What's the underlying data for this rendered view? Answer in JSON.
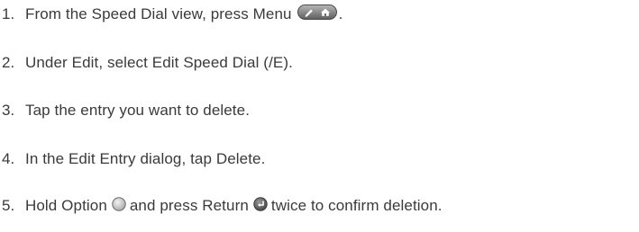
{
  "steps": [
    {
      "number": "1.",
      "text": "From the Speed Dial view, press Menu",
      "after": "."
    },
    {
      "number": "2.",
      "text": "Under Edit, select Edit Speed Dial (/E)."
    },
    {
      "number": "3.",
      "text": "Tap the entry you want to delete."
    },
    {
      "number": "4.",
      "text": "In the Edit Entry dialog, tap Delete."
    },
    {
      "number": "5.",
      "text_a": "Hold Option",
      "text_b": "and press Return",
      "text_c": "twice to confirm deletion."
    }
  ],
  "icons": {
    "menu_key": "menu-key-icon",
    "option_key": "option-key-icon",
    "return_key": "return-key-icon"
  },
  "colors": {
    "text": "#3a3a3a",
    "key_gray": "#8a8a8a"
  }
}
